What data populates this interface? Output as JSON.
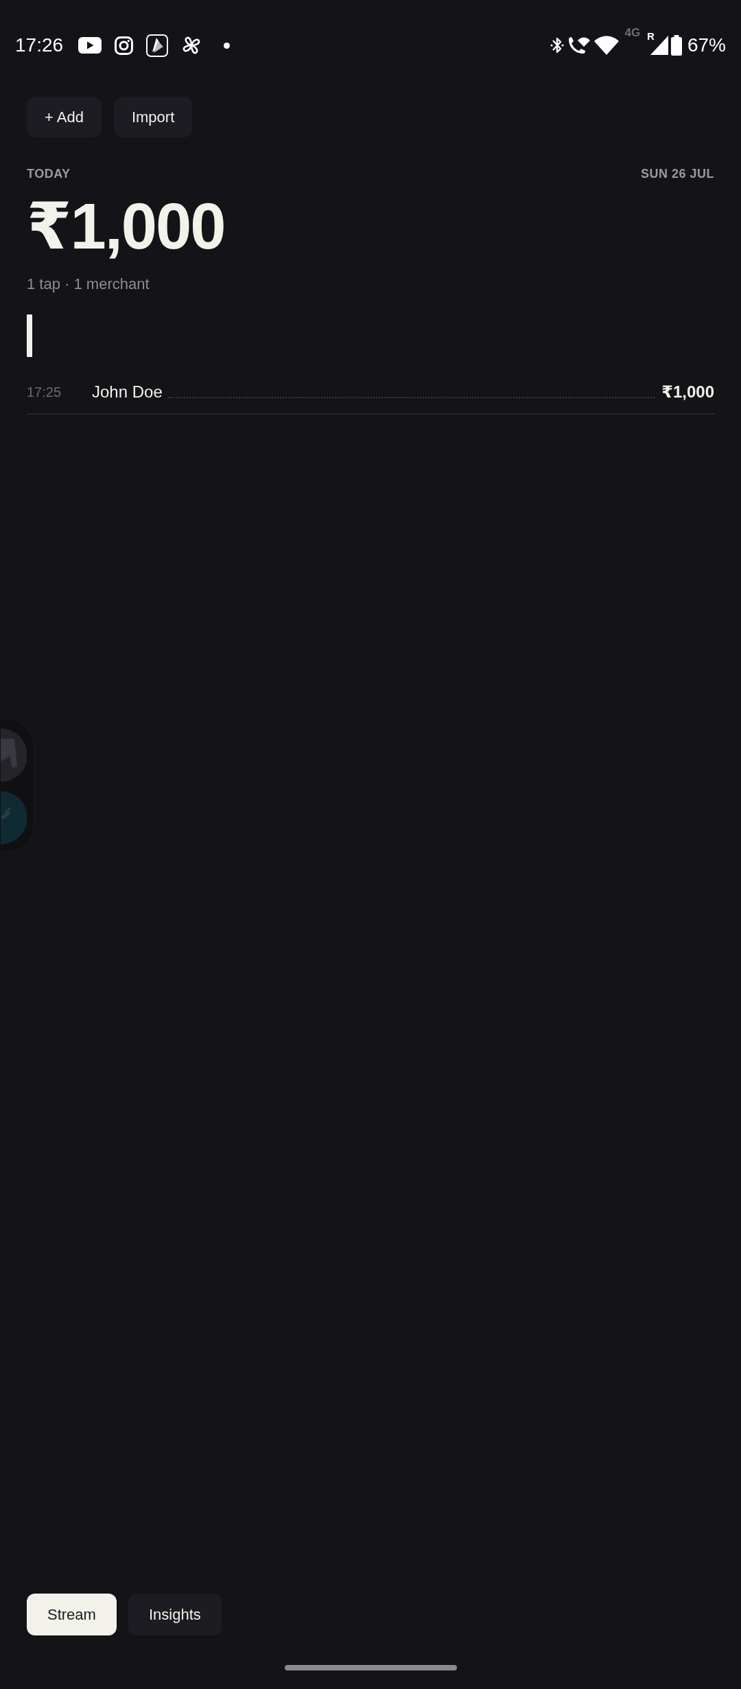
{
  "status_bar": {
    "time": "17:26",
    "network": "4G",
    "roaming": "R",
    "battery": "67%"
  },
  "actions": [
    {
      "label": "+ Add"
    },
    {
      "label": "Import"
    }
  ],
  "summary": {
    "period": "TODAY",
    "date": "SUN 26 JUL",
    "total": "₹1,000",
    "subtitle": "1 tap · 1 merchant"
  },
  "transactions": [
    {
      "time": "17:25",
      "merchant": "John Doe",
      "amount": "₹1,000"
    }
  ],
  "tabs": [
    {
      "label": "Stream",
      "selected": true
    },
    {
      "label": "Insights",
      "selected": false
    }
  ]
}
